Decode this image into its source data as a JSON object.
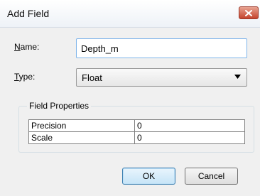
{
  "window": {
    "title": "Add Field",
    "close_icon": "close-x-icon"
  },
  "form": {
    "name_label_accel": "N",
    "name_label_rest": "ame:",
    "name_value": "Depth_m",
    "type_label_accel": "T",
    "type_label_rest": "ype:",
    "type_value": "Float",
    "type_arrow_icon": "chevron-down-icon"
  },
  "field_properties": {
    "legend": "Field Properties",
    "rows": [
      {
        "name": "Precision",
        "value": "0"
      },
      {
        "name": "Scale",
        "value": "0"
      }
    ]
  },
  "buttons": {
    "ok_label": "OK",
    "cancel_label": "Cancel"
  },
  "colors": {
    "close_button": "#c5432c",
    "focus_border": "#7eb4ea",
    "default_button_border": "#3c7fb1"
  }
}
